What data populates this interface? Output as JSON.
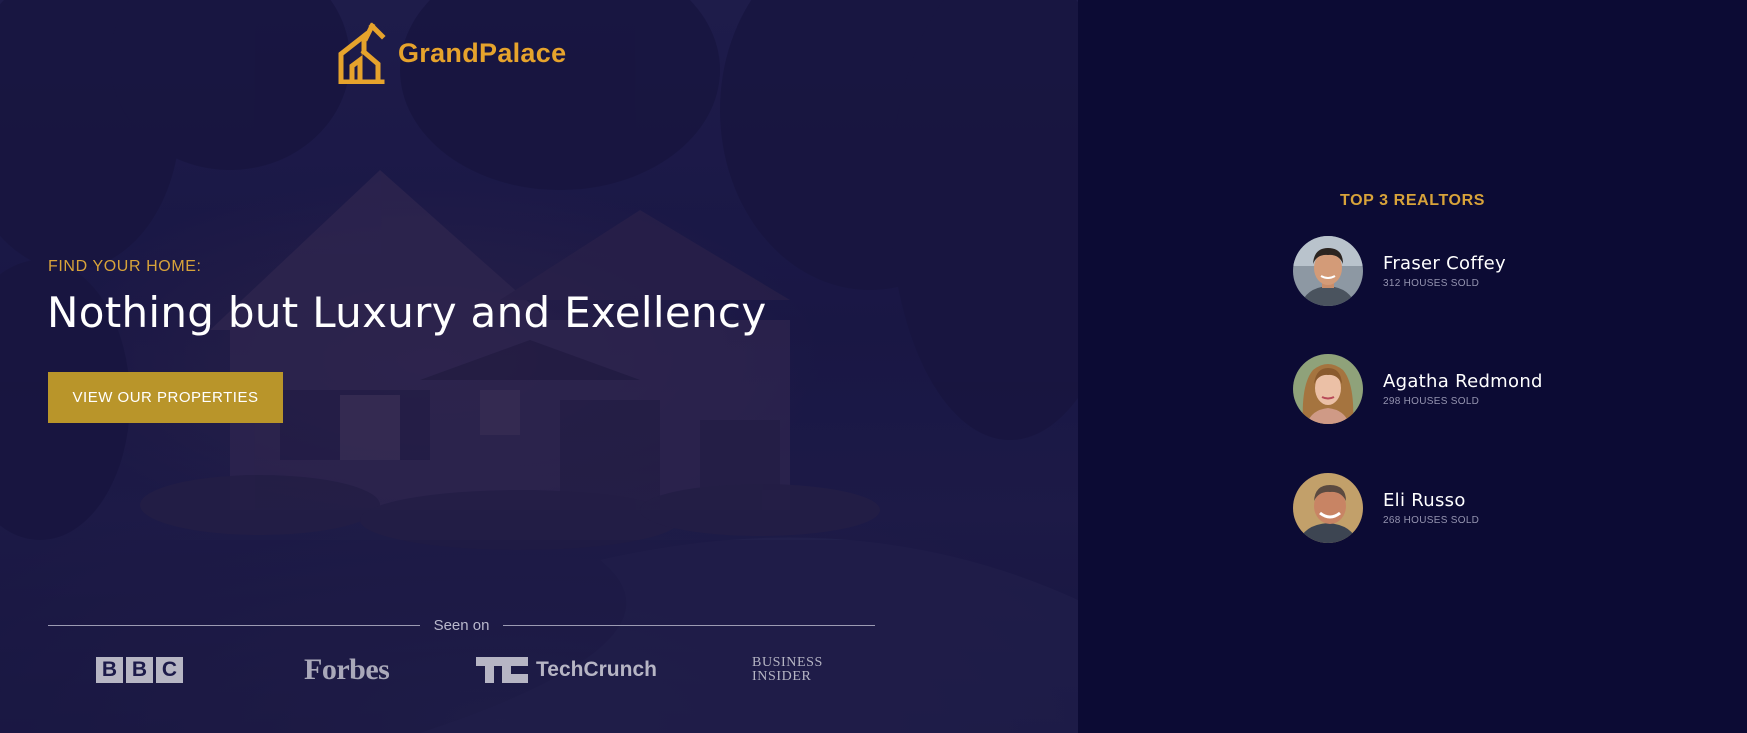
{
  "brand": {
    "name": "GrandPalace",
    "accent": "#e6a32c"
  },
  "hero": {
    "eyebrow": "FIND YOUR HOME:",
    "headline": "Nothing but Luxury and Exellency",
    "cta_label": "VIEW OUR PROPERTIES",
    "cta_color": "#b9952a"
  },
  "press": {
    "label": "Seen on",
    "logos": [
      {
        "name": "BBC",
        "letters": [
          "B",
          "B",
          "C"
        ]
      },
      {
        "name": "Forbes"
      },
      {
        "name": "TechCrunch"
      },
      {
        "name": "Business Insider",
        "line1": "BUSINESS",
        "line2": "INSIDER"
      }
    ]
  },
  "realtors": {
    "title": "TOP 3 REALTORS",
    "items": [
      {
        "name": "Fraser Coffey",
        "sold": "312 HOUSES SOLD"
      },
      {
        "name": "Agatha Redmond",
        "sold": "298 HOUSES SOLD"
      },
      {
        "name": "Eli Russo",
        "sold": "268 HOUSES SOLD"
      }
    ]
  }
}
